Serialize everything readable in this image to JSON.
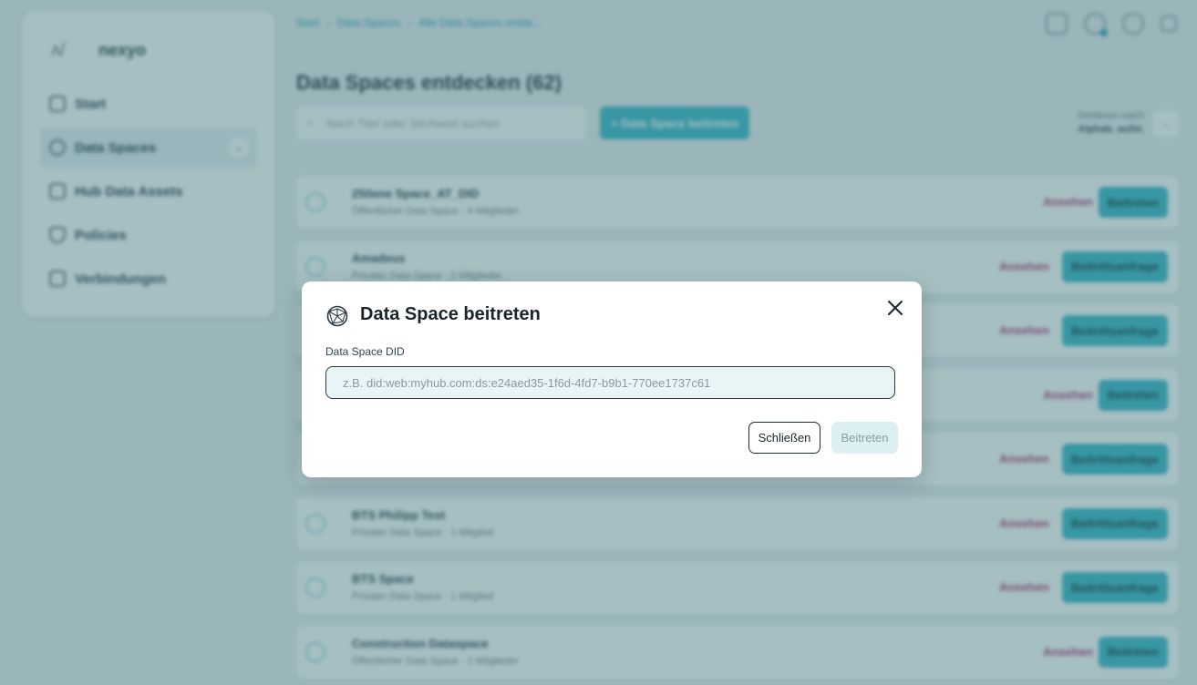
{
  "app": {
    "brand_name": "nexyo"
  },
  "sidebar": {
    "items": [
      {
        "label": "Start",
        "icon": "home-icon"
      },
      {
        "label": "Data Spaces",
        "icon": "globe-icon",
        "active": true
      },
      {
        "label": "Hub Data Assets",
        "icon": "database-icon"
      },
      {
        "label": "Policies",
        "icon": "shield-icon"
      },
      {
        "label": "Verbindungen",
        "icon": "link-icon"
      }
    ]
  },
  "header": {
    "breadcrumb": [
      "Start",
      "Data Spaces",
      "Alle Data Spaces entde..."
    ],
    "title": "Data Spaces entdecken (62)"
  },
  "toolbar": {
    "search_placeholder": "Nach Titel oder Stichwort suchen",
    "join_label": "+ Data Space beitreten",
    "sort_label": "Sortieren nach:",
    "sort_value": "Alphab. aufst."
  },
  "spaces": [
    {
      "name": "250ene Space_AT_DID",
      "sub": "Öffentlicher Data Space · 4 Mitglieder",
      "view": "Ansehen",
      "action": "Beitreten"
    },
    {
      "name": "Amadeus",
      "sub": "Privater Data Space · 2 Mitglieder",
      "view": "Ansehen",
      "action": "Beitrittsanfrage"
    },
    {
      "name": "",
      "sub": "",
      "view": "Ansehen",
      "action": "Beitrittsanfrage"
    },
    {
      "name": "",
      "sub": "",
      "view": "Ansehen",
      "action": "Beitreten"
    },
    {
      "name": "",
      "sub": "",
      "view": "Ansehen",
      "action": "Beitrittsanfrage"
    },
    {
      "name": "BTS Philipp Test",
      "sub": "Privater Data Space · 1 Mitglied",
      "view": "Ansehen",
      "action": "Beitrittsanfrage"
    },
    {
      "name": "BTS Space",
      "sub": "Privater Data Space · 1 Mitglied",
      "view": "Ansehen",
      "action": "Beitrittsanfrage"
    },
    {
      "name": "Construction Dataspace",
      "sub": "Öffentlicher Data Space · 2 Mitglieder",
      "view": "Ansehen",
      "action": "Beitreten"
    }
  ],
  "modal": {
    "title": "Data Space beitreten",
    "field_label": "Data Space DID",
    "field_value": "",
    "field_placeholder": "z.B. did:web:myhub.com:ds:e24aed35-1f6d-4fd7-b9b1-770ee1737c61",
    "close_label": "Schließen",
    "submit_label": "Beitreten"
  },
  "colors": {
    "accent": "#37b6c7",
    "overlay": "#3a707a",
    "view_link": "#b0356a"
  }
}
